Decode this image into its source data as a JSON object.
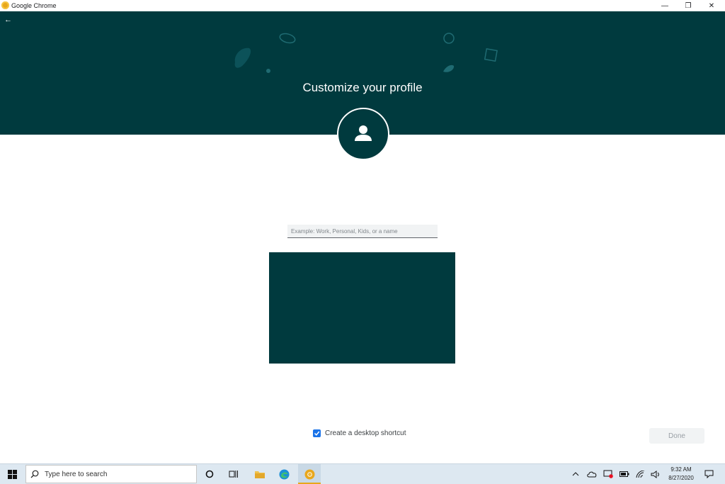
{
  "window": {
    "title": "Google Chrome"
  },
  "window_controls": {
    "minimize": "—",
    "maximize": "❐",
    "close": "✕"
  },
  "header": {
    "back_icon": "←",
    "heading": "Customize your profile"
  },
  "form": {
    "name_placeholder": "Example: Work, Personal, Kids, or a name",
    "name_value": ""
  },
  "shortcut": {
    "label": "Create a desktop shortcut",
    "checked": true
  },
  "done_button": {
    "label": "Done",
    "enabled": false
  },
  "taskbar": {
    "search_placeholder": "Type here to search",
    "time": "9:32 AM",
    "date": "8/27/2020"
  },
  "colors": {
    "theme": "#003a3e",
    "accent": "#1a73e8",
    "chrome_yellow": "#e8a71c"
  }
}
